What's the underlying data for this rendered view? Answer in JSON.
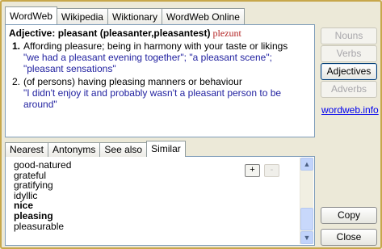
{
  "top_tabs": [
    "WordWeb",
    "Wikipedia",
    "Wiktionary",
    "WordWeb Online"
  ],
  "definition": {
    "pos": "Adjective:",
    "headword": "pleasant (pleasanter,pleasantest)",
    "pronunciation": "plezunt",
    "senses": [
      {
        "num": "1.",
        "gloss": "Affording pleasure; being in harmony with your taste or likings",
        "example": "\"we had a pleasant evening together\"; \"a pleasant scene\"; \"pleasant sensations\""
      },
      {
        "num": "2.",
        "gloss": "(of persons) having pleasing manners or behaviour",
        "example": "\"I didn't enjoy it and probably wasn't a pleasant person to be around\""
      }
    ]
  },
  "side_buttons": {
    "nouns": "Nouns",
    "verbs": "Verbs",
    "adjectives": "Adjectives",
    "adverbs": "Adverbs",
    "link": "wordweb.info",
    "copy": "Copy",
    "close": "Close"
  },
  "bottom_tabs": [
    "Nearest",
    "Antonyms",
    "See also",
    "Similar"
  ],
  "similar_words": [
    {
      "text": "good-natured",
      "bold": false
    },
    {
      "text": "grateful",
      "bold": false
    },
    {
      "text": "gratifying",
      "bold": false
    },
    {
      "text": "idyllic",
      "bold": false
    },
    {
      "text": "nice",
      "bold": true
    },
    {
      "text": "pleasing",
      "bold": true
    },
    {
      "text": "pleasurable",
      "bold": false
    }
  ],
  "mini_buttons": {
    "plus": "+",
    "minus": "-"
  }
}
